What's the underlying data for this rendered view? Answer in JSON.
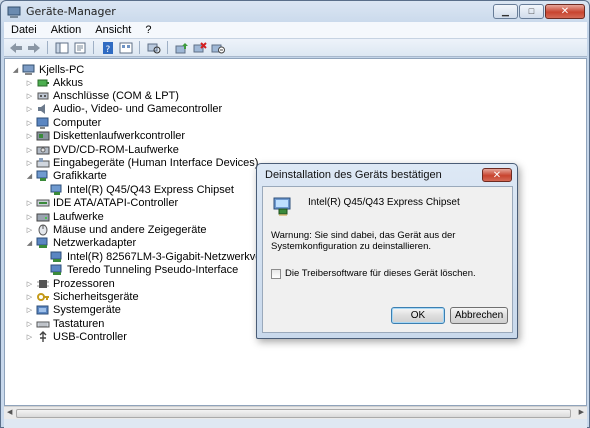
{
  "window": {
    "title": "Geräte-Manager",
    "minimize_glyph": "▁",
    "maximize_glyph": "□",
    "close_glyph": "✕"
  },
  "menu": [
    "Datei",
    "Aktion",
    "Ansicht",
    "?"
  ],
  "toolbar": [
    "back-icon",
    "forward-icon",
    "show-hide-console-tree-icon",
    "properties-icon",
    "help-icon",
    "view-icon",
    "scan-hardware-icon",
    "update-driver-icon",
    "uninstall-icon",
    "disable-icon"
  ],
  "tree": {
    "root": "Kjells-PC",
    "items": [
      {
        "label": "Akkus",
        "icon": "battery-icon",
        "expander": "▷"
      },
      {
        "label": "Anschlüsse (COM & LPT)",
        "icon": "port-icon",
        "expander": "▷"
      },
      {
        "label": "Audio-, Video- und Gamecontroller",
        "icon": "speaker-icon",
        "expander": "▷"
      },
      {
        "label": "Computer",
        "icon": "computer-icon",
        "expander": "▷"
      },
      {
        "label": "Diskettenlaufwerkcontroller",
        "icon": "floppy-controller-icon",
        "expander": "▷"
      },
      {
        "label": "DVD/CD-ROM-Laufwerke",
        "icon": "dvd-drive-icon",
        "expander": "▷"
      },
      {
        "label": "Eingabegeräte (Human Interface Devices)",
        "icon": "hid-icon",
        "expander": "▷"
      },
      {
        "label": "Grafikkarte",
        "icon": "display-adapter-icon",
        "expander": "◢"
      },
      {
        "label": "Intel(R) Q45/Q43 Express Chipset",
        "icon": "display-adapter-icon",
        "expander": "",
        "child": true
      },
      {
        "label": "IDE ATA/ATAPI-Controller",
        "icon": "ide-controller-icon",
        "expander": "▷"
      },
      {
        "label": "Laufwerke",
        "icon": "disk-drive-icon",
        "expander": "▷"
      },
      {
        "label": "Mäuse und andere Zeigegeräte",
        "icon": "mouse-icon",
        "expander": "▷"
      },
      {
        "label": "Netzwerkadapter",
        "icon": "network-adapter-icon",
        "expander": "◢"
      },
      {
        "label": "Intel(R) 82567LM-3-Gigabit-Netzwerkverbindung",
        "icon": "network-adapter-icon",
        "expander": "",
        "child": true
      },
      {
        "label": "Teredo Tunneling Pseudo-Interface",
        "icon": "network-adapter-icon",
        "expander": "",
        "child": true
      },
      {
        "label": "Prozessoren",
        "icon": "processor-icon",
        "expander": "▷"
      },
      {
        "label": "Sicherheitsgeräte",
        "icon": "security-device-icon",
        "expander": "▷"
      },
      {
        "label": "Systemgeräte",
        "icon": "system-device-icon",
        "expander": "▷"
      },
      {
        "label": "Tastaturen",
        "icon": "keyboard-icon",
        "expander": "▷"
      },
      {
        "label": "USB-Controller",
        "icon": "usb-icon",
        "expander": "▷"
      }
    ]
  },
  "dialog": {
    "title": "Deinstallation des Geräts bestätigen",
    "close_glyph": "✕",
    "device_name": "Intel(R) Q45/Q43 Express Chipset",
    "warning": "Warnung: Sie sind dabei, das Gerät aus der Systemkonfiguration zu deinstallieren.",
    "checkbox_label": "Die Treibersoftware für dieses Gerät löschen.",
    "checkbox_checked": false,
    "ok_label": "OK",
    "cancel_label": "Abbrechen"
  },
  "colors": {
    "accent": "#3c7fb1",
    "close_red": "#c8442f"
  }
}
